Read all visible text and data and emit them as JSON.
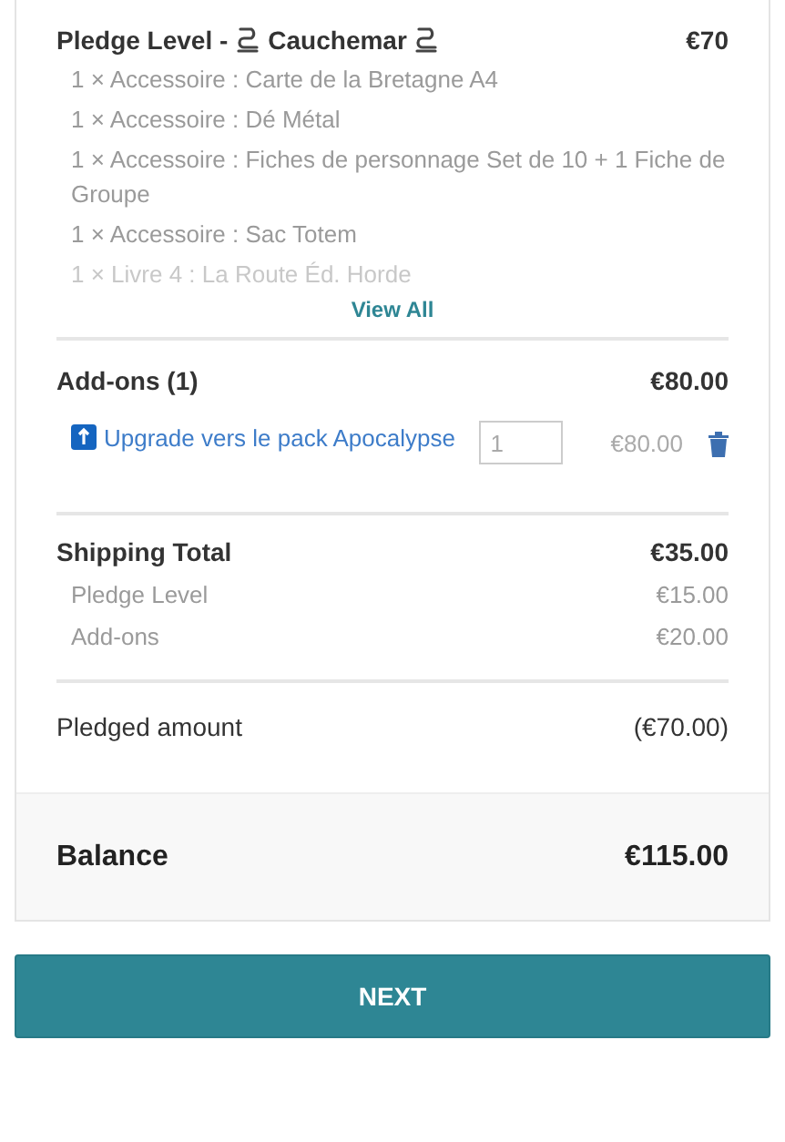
{
  "pledge": {
    "title": "Pledge Level - ",
    "name": "Cauchemar",
    "price": "€70",
    "items": [
      {
        "text": "1 × Accessoire : Carte de la Bretagne A4",
        "faded": false
      },
      {
        "text": "1 × Accessoire : Dé Métal",
        "faded": false
      },
      {
        "text": "1 × Accessoire : Fiches de personnage Set de 10 + 1 Fiche de Groupe",
        "faded": false
      },
      {
        "text": "1 × Accessoire : Sac Totem",
        "faded": false
      },
      {
        "text": "1 × Livre 4 : La Route Éd. Horde",
        "faded": true
      }
    ],
    "view_all": "View All"
  },
  "addons": {
    "title": "Add-ons (1)",
    "total": "€80.00",
    "items": [
      {
        "name": "Upgrade vers le pack Apocalypse",
        "quantity": "1",
        "price": "€80.00"
      }
    ]
  },
  "shipping": {
    "title": "Shipping Total",
    "total": "€35.00",
    "rows": [
      {
        "label": "Pledge Level",
        "amount": "€15.00"
      },
      {
        "label": "Add-ons",
        "amount": "€20.00"
      }
    ]
  },
  "pledged": {
    "label": "Pledged amount",
    "amount": "(€70.00)"
  },
  "balance": {
    "label": "Balance",
    "amount": "€115.00"
  },
  "next_button": "NEXT"
}
